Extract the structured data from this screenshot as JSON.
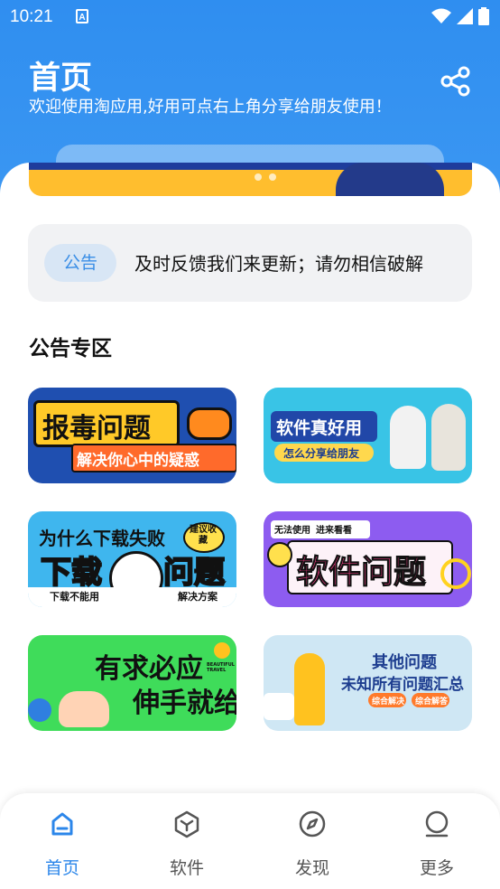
{
  "status": {
    "time": "10:21",
    "notif_icon": "A"
  },
  "header": {
    "title": "首页",
    "subtitle": "欢迎使用淘应用,好用可点右上角分享给朋友使用！",
    "share_icon": "share-icon"
  },
  "notice": {
    "tag": "公告",
    "text": "及时反馈我们来更新；请勿相信破解"
  },
  "section": {
    "title": "公告专区"
  },
  "cards": [
    {
      "title": "报毒问题",
      "sub": "解决你心中的疑惑"
    },
    {
      "title": "软件真好用",
      "sub": "怎么分享给朋友"
    },
    {
      "title": "为什么下载失败",
      "title2": "下载",
      "title3": "问题",
      "badge": "建议收藏",
      "foot_left": "下载不能用",
      "foot_right": "解决方案"
    },
    {
      "title": "软件问题",
      "top_left": "无法使用",
      "top_right": "进来看看"
    },
    {
      "title": "有求必应",
      "title2": "伸手就给",
      "tag": "BEAUTIFUL TRAVEL"
    },
    {
      "title": "其他问题",
      "sub": "未知所有问题汇总",
      "pill1": "综合解决",
      "pill2": "综合解答"
    }
  ],
  "nav": [
    {
      "label": "首页",
      "icon": "home-icon",
      "active": true
    },
    {
      "label": "软件",
      "icon": "box-icon",
      "active": false
    },
    {
      "label": "发现",
      "icon": "compass-icon",
      "active": false
    },
    {
      "label": "更多",
      "icon": "user-icon",
      "active": false
    }
  ],
  "colors": {
    "accent": "#2b86ea",
    "header": "#3b97f2"
  }
}
